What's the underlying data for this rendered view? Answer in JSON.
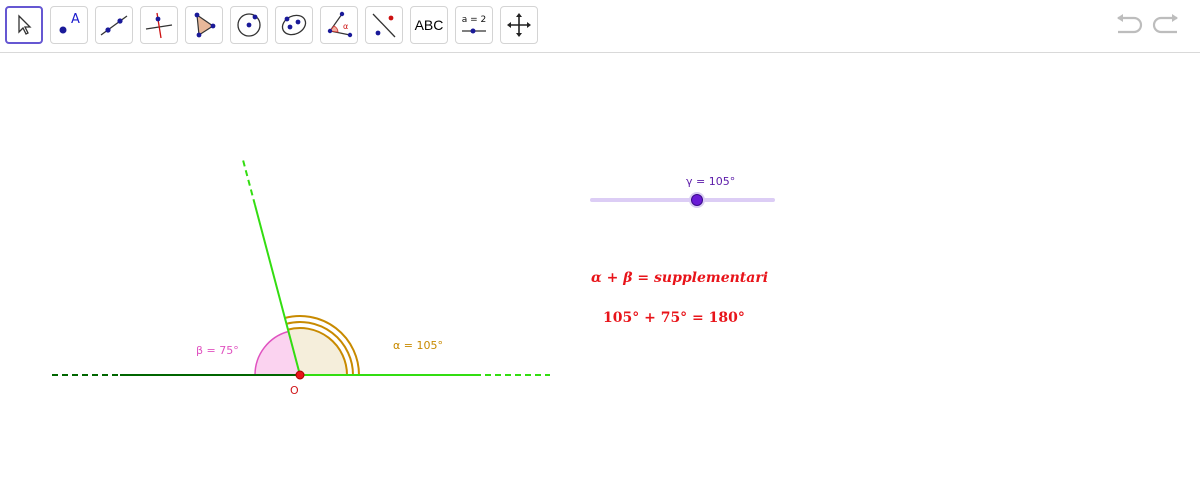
{
  "toolbar": {
    "tools": [
      {
        "name": "move-tool",
        "icon": "arrow-pointer-icon",
        "selected": true
      },
      {
        "name": "point-tool",
        "icon": "point-icon",
        "label": "A"
      },
      {
        "name": "line-tool",
        "icon": "line-through-points-icon"
      },
      {
        "name": "perpendicular-line-tool",
        "icon": "perpendicular-line-icon"
      },
      {
        "name": "polygon-tool",
        "icon": "polygon-icon"
      },
      {
        "name": "circle-center-point-tool",
        "icon": "circle-center-icon"
      },
      {
        "name": "ellipse-tool",
        "icon": "ellipse-icon"
      },
      {
        "name": "angle-tool",
        "icon": "angle-icon",
        "label": "α"
      },
      {
        "name": "reflect-tool",
        "icon": "reflect-line-icon"
      },
      {
        "name": "text-tool",
        "icon": "text-icon",
        "label": "ABC"
      },
      {
        "name": "slider-tool",
        "icon": "slider-icon",
        "label": "a = 2"
      },
      {
        "name": "move-view-tool",
        "icon": "move-arrows-icon"
      }
    ],
    "undo_icon": "undo-icon",
    "redo_icon": "redo-icon"
  },
  "slider": {
    "label": "γ = 105°",
    "value": 105,
    "min": 0,
    "max": 180,
    "track_color": "#dccdf5",
    "knob_color": "#6a1ad6"
  },
  "equations": {
    "line1": "α + β = supplementari",
    "line2": "105° + 75° = 180°",
    "color": "#e8141a"
  },
  "angles": {
    "beta_label": "β = 75°",
    "alpha_label": "α = 105°",
    "beta_value": 75,
    "alpha_value": 105,
    "beta_color": "#e052c0",
    "alpha_color": "#c88a00"
  },
  "point_label": "O",
  "colors": {
    "light_green": "#33dd11",
    "dark_green": "#006600",
    "point_red": "#e8141a"
  }
}
